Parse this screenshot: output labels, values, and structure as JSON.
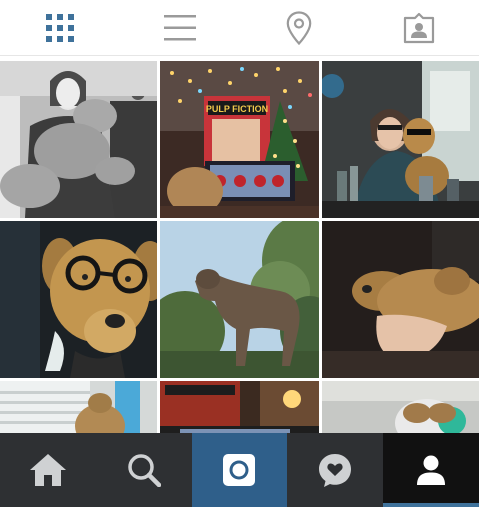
{
  "colors": {
    "accent": "#3f729b",
    "nav_bg": "#2e3033",
    "camera_bg": "#2f5f8a",
    "profile_bg": "#111111",
    "tab_inactive": "#999999"
  },
  "top_tabs": [
    {
      "icon": "grid-icon",
      "active": true
    },
    {
      "icon": "list-icon",
      "active": false
    },
    {
      "icon": "location-pin-icon",
      "active": false
    },
    {
      "icon": "tagged-photos-icon",
      "active": false
    }
  ],
  "photos": [
    {
      "subject": "girl-hugging-stuffed-dog"
    },
    {
      "subject": "pulp-fiction-poster-christmas-tree"
    },
    {
      "subject": "girl-with-stuffed-dog-sunglasses"
    },
    {
      "subject": "stuffed-dog-with-glasses"
    },
    {
      "subject": "stuffed-dog-against-trees"
    },
    {
      "subject": "stuffed-dog-sleeping"
    },
    {
      "subject": "stuffed-dog-window"
    },
    {
      "subject": "pulp-fiction-poster-monitor"
    },
    {
      "subject": "stuffed-dog-blue-light"
    }
  ],
  "bottom_nav": [
    {
      "icon": "home-icon"
    },
    {
      "icon": "search-icon"
    },
    {
      "icon": "camera-icon"
    },
    {
      "icon": "activity-heart-icon"
    },
    {
      "icon": "profile-icon"
    }
  ],
  "poster_text": "PULP FICTION"
}
